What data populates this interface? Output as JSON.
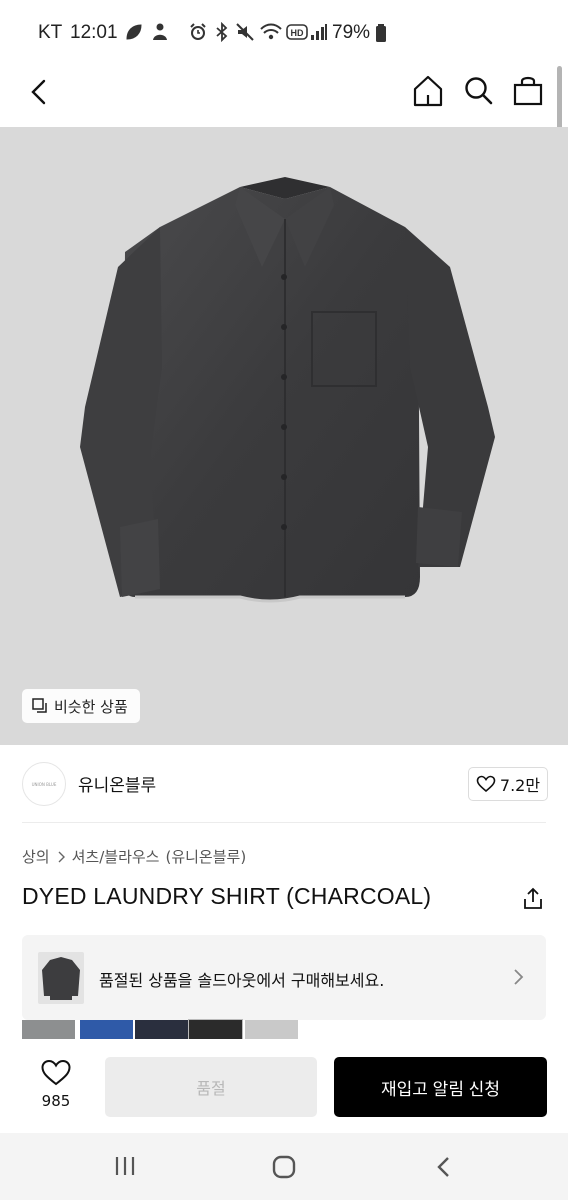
{
  "status_bar": {
    "carrier": "KT",
    "time": "12:01",
    "battery": "79%"
  },
  "header": {
    "back_icon": "chevron-left-icon",
    "home_icon": "home-icon",
    "search_icon": "search-icon",
    "cart_icon": "shopping-bag-icon"
  },
  "hero": {
    "similar_label": "비슷한 상품"
  },
  "brand": {
    "logo_text": "UNION BLUE",
    "name": "유니온블루",
    "likes": "7.2만"
  },
  "breadcrumb": {
    "items": [
      "상의",
      "셔츠/블라우스",
      "(유니온블루)"
    ]
  },
  "product": {
    "title": "DYED LAUNDRY SHIRT (CHARCOAL)"
  },
  "banner": {
    "text": "품절된 상품을 솔드아웃에서 구매해보세요."
  },
  "swatches": {
    "colors": [
      "#8d8f90",
      "#2f5aa8",
      "#2a2f3e",
      "#2b2b2b",
      "#c9c9c9"
    ]
  },
  "bottom_bar": {
    "wish_count": "985",
    "soldout_label": "품절",
    "restock_label": "재입고 알림 신청"
  },
  "colors": {
    "primary_button": "#000000",
    "disabled_button": "#ececec",
    "hero_background": "#d9d9d9"
  }
}
